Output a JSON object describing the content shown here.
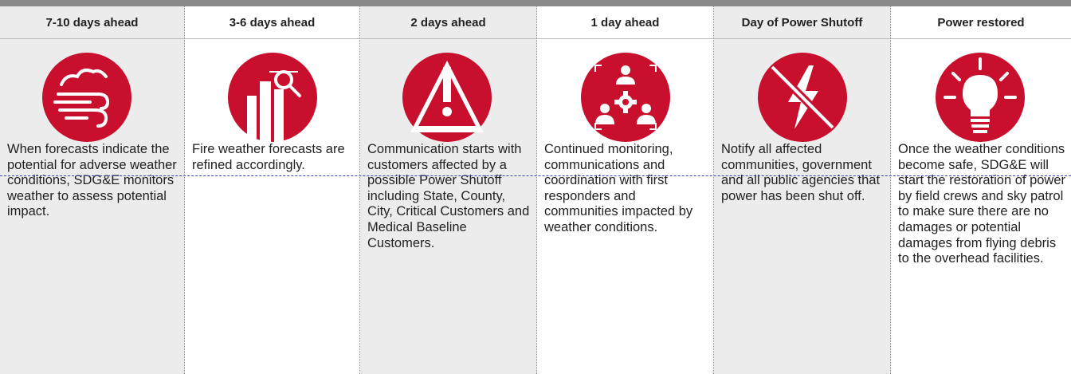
{
  "colors": {
    "accent": "#c8102e",
    "shade": "#ececec",
    "topbar": "#8a8a8a",
    "guide": "#3f3fb8"
  },
  "columns": [
    {
      "title": "7-10 days ahead",
      "icon": "weather-wind-cloud-icon",
      "text": "When forecasts indicate the potential for adverse weather conditions, SDG&E monitors weather to assess potential impact."
    },
    {
      "title": "3-6 days ahead",
      "icon": "forecast-search-icon",
      "text": "Fire weather forecasts are refined accordingly."
    },
    {
      "title": "2 days ahead",
      "icon": "warning-icon",
      "text": "Communication starts with customers affected by a possible Power Shutoff including State, County, City, Critical Customers and Medical Baseline Customers."
    },
    {
      "title": "1 day ahead",
      "icon": "coordination-team-icon",
      "text": "Continued monitoring, communications and coordination with first responders and communities impacted by weather conditions."
    },
    {
      "title": "Day of Power Shutoff",
      "icon": "power-off-icon",
      "text": "Notify all affected communities, government and all public agencies that power has been shut off."
    },
    {
      "title": "Power restored",
      "icon": "light-bulb-icon",
      "text": "Once the weather conditions become safe, SDG&E will start the restoration of power by field crews and sky patrol to make sure there are no damages or potential damages from flying debris to the overhead facilities."
    }
  ]
}
